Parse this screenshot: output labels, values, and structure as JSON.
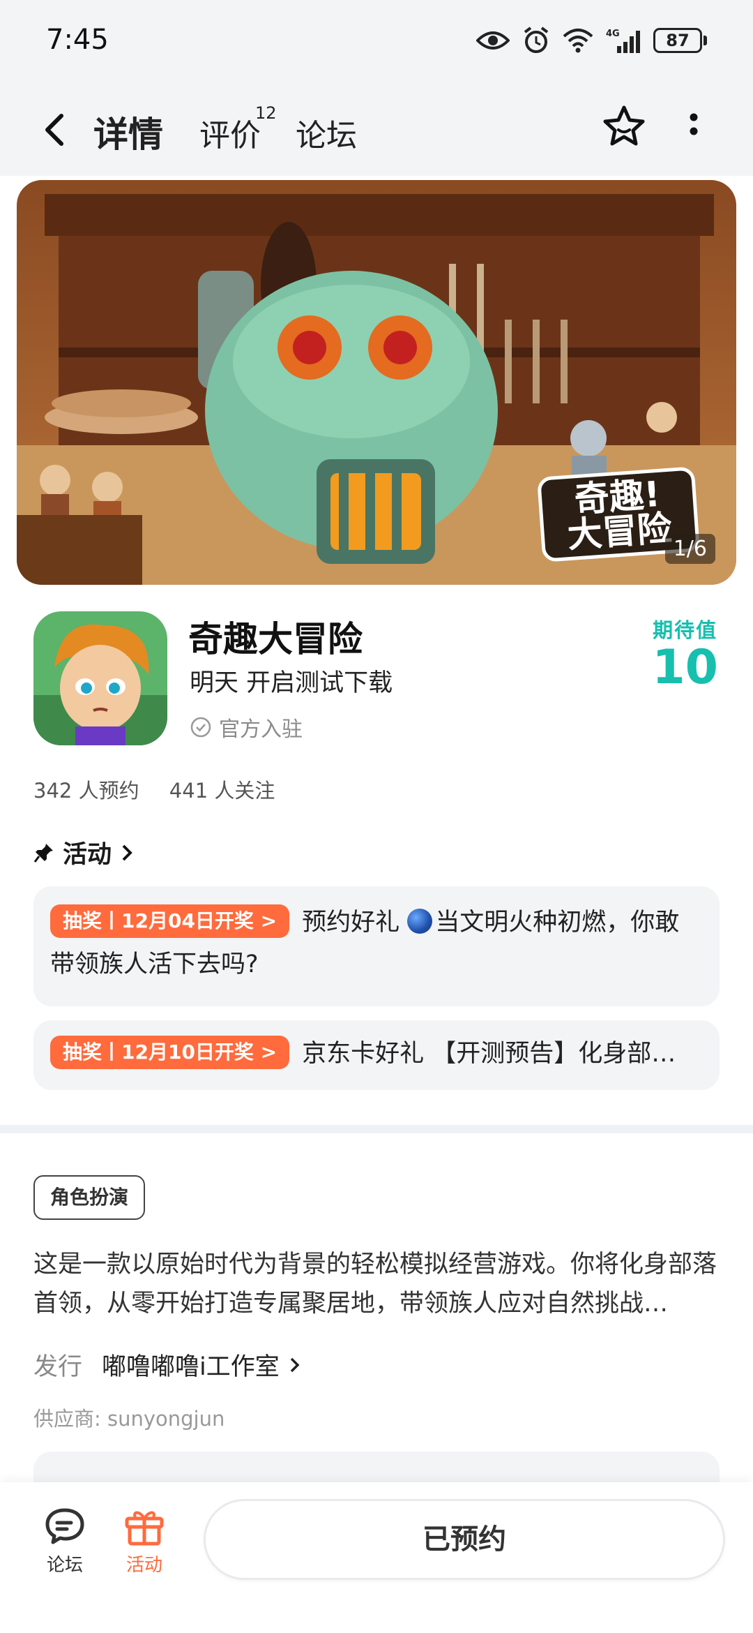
{
  "status_bar": {
    "time": "7:45",
    "battery": "87",
    "network": "4G"
  },
  "header": {
    "tabs": [
      {
        "label": "详情",
        "active": true
      },
      {
        "label": "评价",
        "badge": "12"
      },
      {
        "label": "论坛"
      }
    ]
  },
  "banner": {
    "counter": "1/6",
    "logo_line1": "奇趣!",
    "logo_line2": "大冒险"
  },
  "game": {
    "title": "奇趣大冒险",
    "subtitle": "明天 开启测试下载",
    "official": "官方入驻",
    "expect_label": "期待值",
    "expect_value": "10",
    "reservations": "342 人预约",
    "followers": "441 人关注"
  },
  "activity": {
    "heading": "活动",
    "items": [
      {
        "pill": "抽奖丨12月04日开奖 >",
        "text_before": "预约好礼 ",
        "text_after": "当文明火种初燃，你敢带领族人活下去吗?"
      },
      {
        "pill": "抽奖丨12月10日开奖 >",
        "text": "京东卡好礼 【开测预告】化身部…"
      }
    ]
  },
  "about": {
    "genre": "角色扮演",
    "description": "这是一款以原始时代为背景的轻松模拟经营游戏。你将化身部落首领，从零开始打造专属聚居地，带领族人应对自然挑战…",
    "publisher_label": "发行",
    "publisher": "嘟噜嘟噜i工作室",
    "supplier": "供应商: sunyongjun"
  },
  "bottom_bar": {
    "forum_label": "论坛",
    "activity_label": "活动",
    "reserve_label": "已预约"
  },
  "colors": {
    "accent": "#17bfae",
    "orange": "#ff6b3d"
  }
}
